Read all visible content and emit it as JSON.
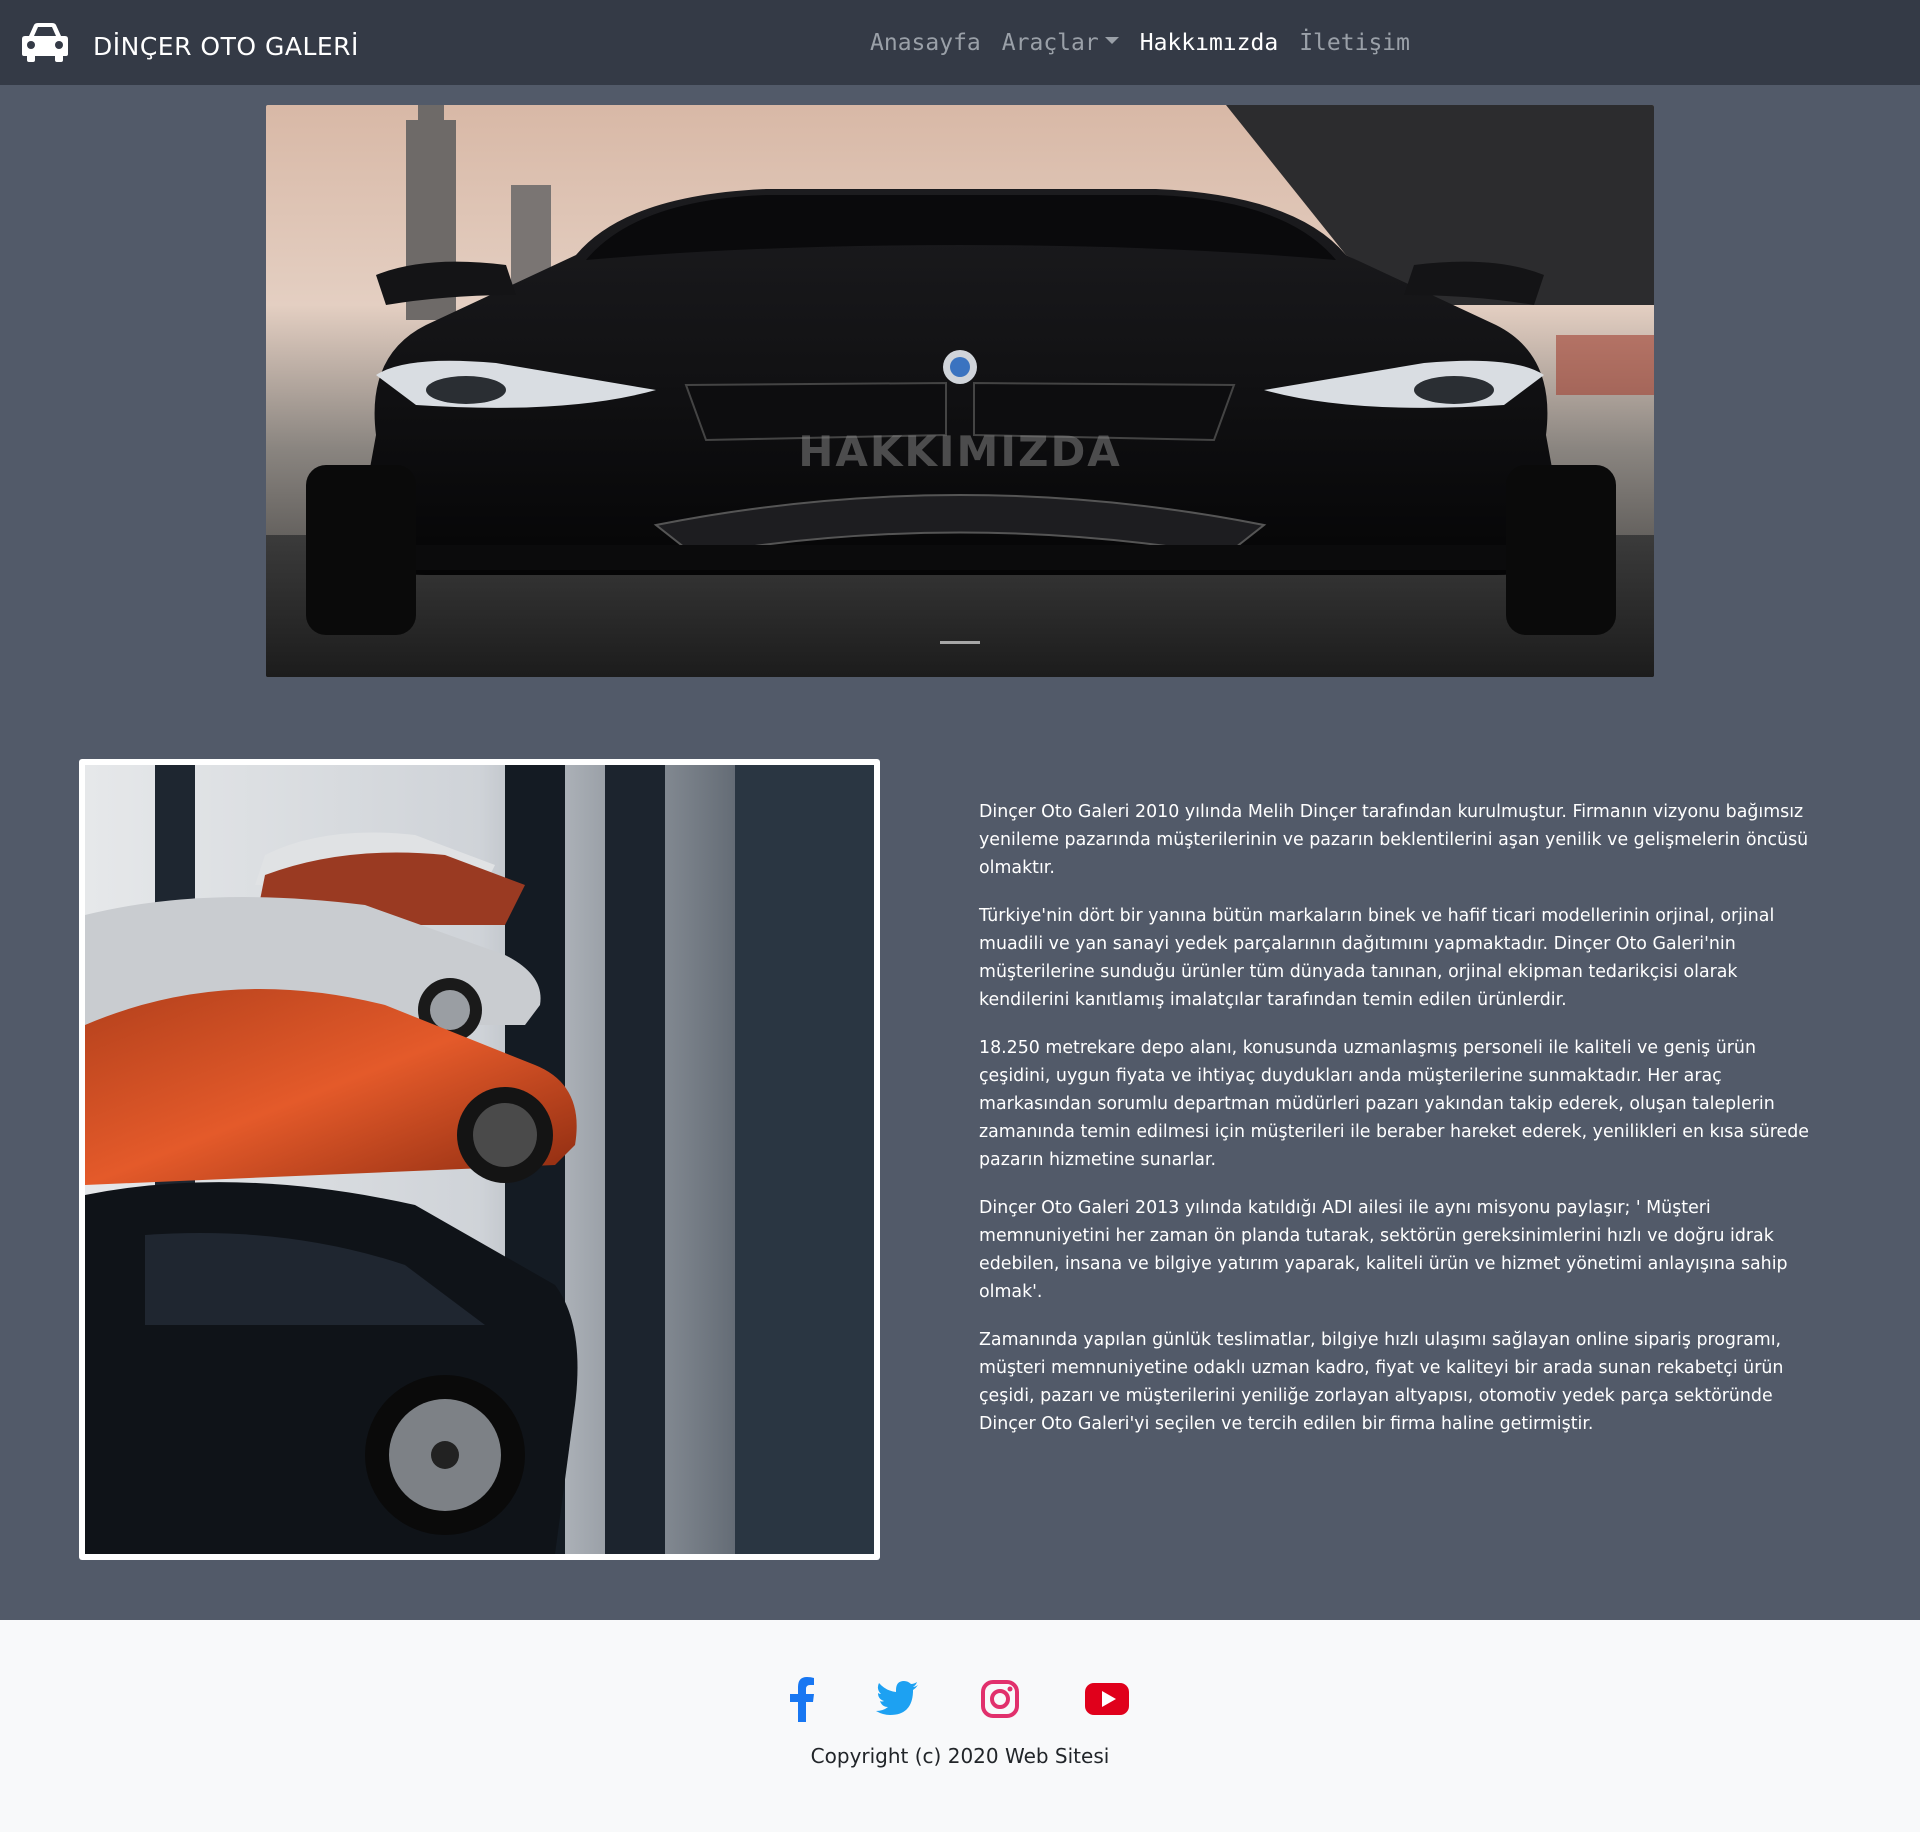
{
  "brand": {
    "name": "DİNÇER OTO GALERİ",
    "icon": "car-icon"
  },
  "nav": {
    "items": [
      {
        "label": "Anasayfa",
        "active": false
      },
      {
        "label": "Araçlar",
        "active": false,
        "dropdown": true
      },
      {
        "label": "Hakkımızda",
        "active": true
      },
      {
        "label": "İletişim",
        "active": false
      }
    ]
  },
  "hero": {
    "title": "HAKKIMIZDA"
  },
  "about": {
    "paragraphs": [
      "Dinçer Oto Galeri 2010 yılında Melih Dinçer tarafından kurulmuştur. Firmanın vizyonu bağımsız yenileme pazarında müşterilerinin ve pazarın beklentilerini aşan yenilik ve gelişmelerin öncüsü olmaktır.",
      "Türkiye'nin dört bir yanına bütün markaların binek ve hafif ticari modellerinin orjinal, orjinal muadili ve yan sanayi yedek parçalarının dağıtımını yapmaktadır. Dinçer Oto Galeri'nin müşterilerine sunduğu ürünler tüm dünyada tanınan, orjinal ekipman tedarikçisi olarak kendilerini kanıtlamış imalatçılar tarafından temin edilen ürünlerdir.",
      "18.250 metrekare depo alanı, konusunda uzmanlaşmış personeli ile kaliteli ve geniş ürün çeşidini, uygun fiyata ve ihtiyaç duydukları anda müşterilerine sunmaktadır. Her araç markasından sorumlu departman müdürleri pazarı yakından takip ederek, oluşan taleplerin zamanında temin edilmesi için müşterileri ile beraber hareket ederek, yenilikleri en kısa sürede pazarın hizmetine sunarlar.",
      "Dinçer Oto Galeri 2013 yılında katıldığı ADI ailesi ile aynı misyonu paylaşır; ' Müşteri memnuniyetini her zaman ön planda tutarak, sektörün gereksinimlerini hızlı ve doğru idrak edebilen, insana ve bilgiye yatırım yaparak, kaliteli ürün ve hizmet yönetimi anlayışına sahip olmak'.",
      "Zamanında yapılan günlük teslimatlar, bilgiye hızlı ulaşımı sağlayan online sipariş programı, müşteri memnuniyetine odaklı uzman kadro, fiyat ve kaliteyi bir arada sunan rekabetçi ürün çeşidi, pazarı ve müşterilerini yeniliğe zorlayan altyapısı, otomotiv yedek parça sektöründe Dinçer Oto Galeri'yi seçilen ve tercih edilen bir firma haline getirmiştir."
    ]
  },
  "footer": {
    "social": [
      {
        "name": "facebook-icon",
        "color": "#1877f2"
      },
      {
        "name": "twitter-icon",
        "color": "#1da1f2"
      },
      {
        "name": "instagram-icon",
        "color": "#e1306c"
      },
      {
        "name": "youtube-icon",
        "color": "#e0001b"
      }
    ],
    "copyright": "Copyright (c) 2020 Web Sitesi"
  },
  "colors": {
    "navbar": "#343a46",
    "page": "#525a69",
    "footer": "#f8f9fa"
  }
}
